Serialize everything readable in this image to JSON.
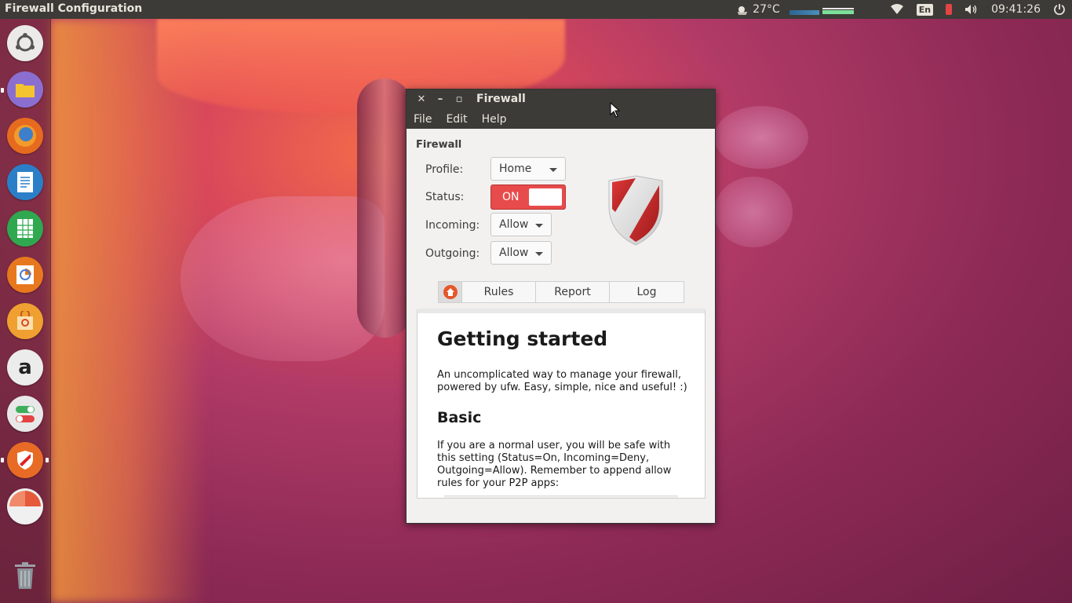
{
  "top_panel": {
    "app_title": "Firewall Configuration",
    "weather": "27°C",
    "keyboard_layout": "En",
    "clock": "09:41:26"
  },
  "launcher": {
    "items": [
      {
        "name": "ubuntu-dash",
        "color": "#ebeae8"
      },
      {
        "name": "files",
        "color": "#8b6fd0"
      },
      {
        "name": "firefox",
        "color": "#e66b1e"
      },
      {
        "name": "writer",
        "color": "#2b7fc8"
      },
      {
        "name": "calc",
        "color": "#2fa84f"
      },
      {
        "name": "impress",
        "color": "#e8781e"
      },
      {
        "name": "software-center",
        "color": "#f0a030"
      },
      {
        "name": "amazon",
        "color": "#ececec"
      },
      {
        "name": "system-settings",
        "color": "#e8e8e8"
      },
      {
        "name": "firewall",
        "color": "#e86b25"
      },
      {
        "name": "disk-usage",
        "color": "#f0f0f0"
      },
      {
        "name": "trash",
        "color": "#9aa0a6"
      }
    ]
  },
  "window": {
    "title": "Firewall",
    "menu": [
      "File",
      "Edit",
      "Help"
    ],
    "section_title": "Firewall",
    "profile_label": "Profile:",
    "profile_value": "Home",
    "status_label": "Status:",
    "status_value": "ON",
    "incoming_label": "Incoming:",
    "incoming_value": "Allow",
    "outgoing_label": "Outgoing:",
    "outgoing_value": "Allow",
    "tabs": [
      "Rules",
      "Report",
      "Log"
    ],
    "content": {
      "heading": "Getting started",
      "intro": "An uncomplicated way to manage your firewall, powered by ufw. Easy, simple, nice and useful! :)",
      "subheading": "Basic",
      "basic_text": "If you are a normal user, you will be safe with this setting (Status=On, Incoming=Deny, Outgoing=Allow). Remember to append allow rules for your P2P apps:"
    }
  },
  "colors": {
    "panel": "#3c3b37",
    "toggle_on": "#e84b4b",
    "accent": "#e5572a"
  }
}
